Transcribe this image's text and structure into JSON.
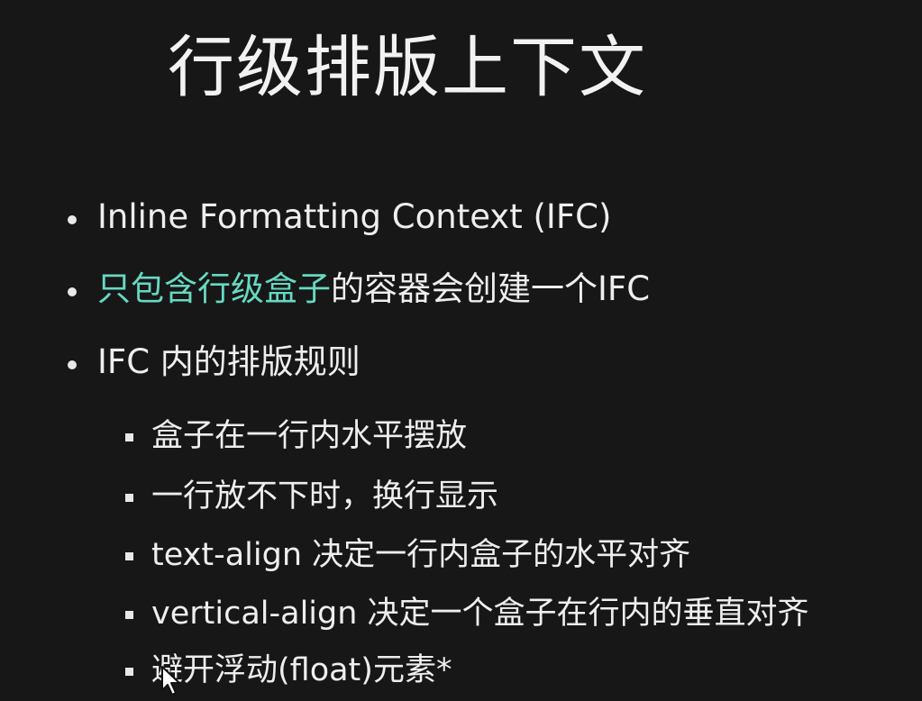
{
  "slide": {
    "title": "行级排版上下文",
    "bullets": [
      "Inline Formatting Context (IFC)",
      {
        "highlight": "只包含行级盒子",
        "rest": "的容器会创建一个IFC"
      },
      "IFC 内的排版规则"
    ],
    "sub_bullets": [
      "盒子在一行内水平摆放",
      "一行放不下时，换行显示",
      "text-align 决定一行内盒子的水平对齐",
      "vertical-align 决定一个盒子在行内的垂直对齐",
      "避开浮动(float)元素*"
    ]
  },
  "colors": {
    "background": "#171717",
    "text": "#eeeeee",
    "highlight": "#67d9c2"
  },
  "icons": {
    "cursor": "mouse-pointer-icon"
  }
}
